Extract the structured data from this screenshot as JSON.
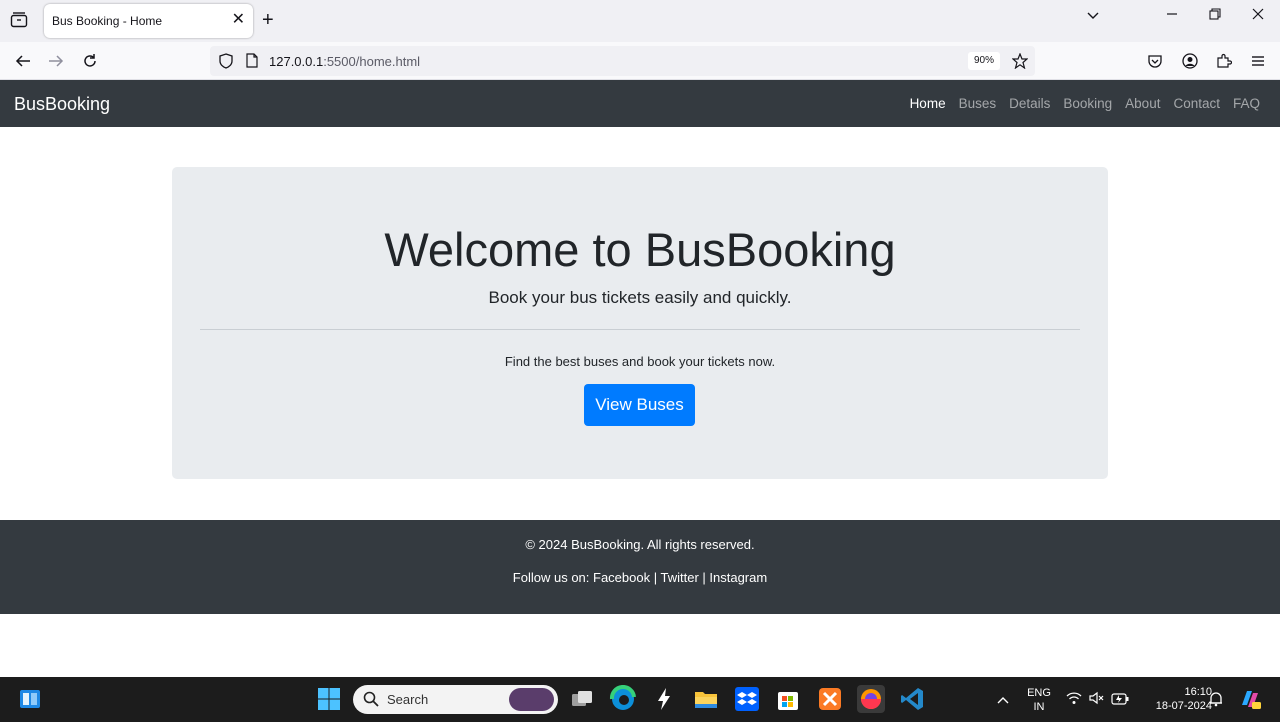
{
  "browser": {
    "tab_title": "Bus Booking - Home",
    "url_host": "127.0.0.1",
    "url_rest": ":5500/home.html",
    "zoom": "90%"
  },
  "site": {
    "brand": "BusBooking",
    "nav": [
      "Home",
      "Buses",
      "Details",
      "Booking",
      "About",
      "Contact",
      "FAQ"
    ],
    "active_nav": "Home"
  },
  "hero": {
    "title": "Welcome to BusBooking",
    "lead": "Book your bus tickets easily and quickly.",
    "text": "Find the best buses and book your tickets now.",
    "button": "View Buses"
  },
  "footer": {
    "copyright": "© 2024 BusBooking. All rights reserved.",
    "follow_prefix": "Follow us on:",
    "links": [
      "Facebook",
      "Twitter",
      "Instagram"
    ]
  },
  "taskbar": {
    "search_placeholder": "Search",
    "lang_top": "ENG",
    "lang_bottom": "IN",
    "time": "16:10",
    "date": "18-07-2024"
  },
  "colors": {
    "navbar": "#343a40",
    "jumbotron": "#e9ecef",
    "primary": "#007bff"
  }
}
